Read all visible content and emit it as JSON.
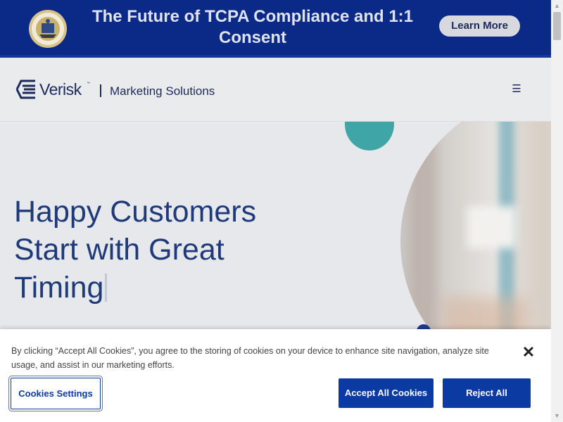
{
  "banner": {
    "title": "The Future of TCPA Compliance and 1:1 Consent",
    "cta_label": "Learn More",
    "background_color": "#0b2a87"
  },
  "header": {
    "logo_text": "Verisk",
    "logo_tm": "™",
    "divider": "|",
    "division": "Marketing Solutions",
    "menu_icon": "☰"
  },
  "hero": {
    "headline": "Happy Customers Start with Great Timing",
    "text_color": "#1e3a78"
  },
  "cookie_banner": {
    "message": "By clicking “Accept All Cookies”, you agree to the storing of cookies on your device to enhance site navigation, analyze site usage, and assist in our marketing efforts.",
    "close_icon": "✕",
    "settings_label": "Cookies Settings",
    "accept_label": "Accept All Cookies",
    "reject_label": "Reject All",
    "accent_color": "#0b3aa3"
  },
  "scrollbar": {
    "up_icon": "▲",
    "down_icon": "▼"
  }
}
